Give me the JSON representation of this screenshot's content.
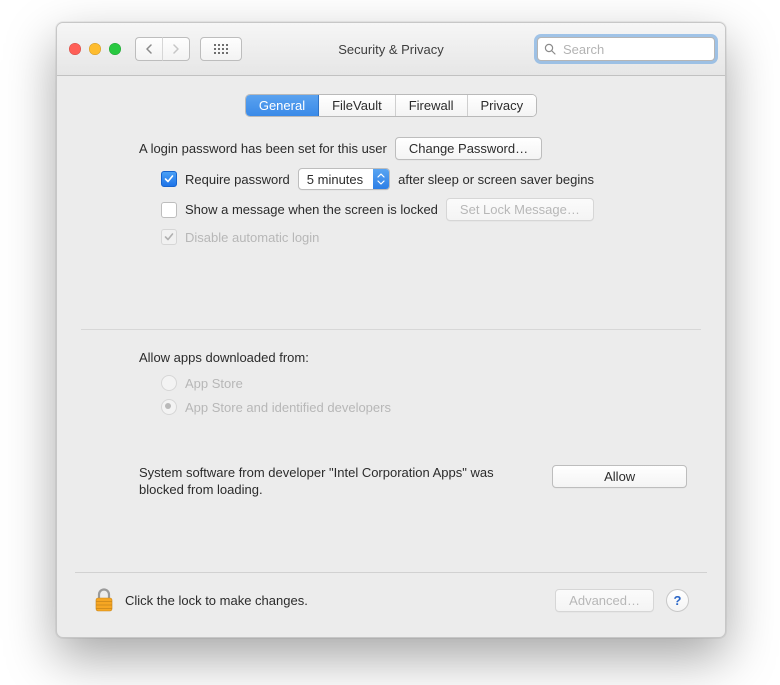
{
  "window": {
    "title": "Security & Privacy"
  },
  "toolbar": {
    "search_placeholder": "Search"
  },
  "tabs": [
    "General",
    "FileVault",
    "Firewall",
    "Privacy"
  ],
  "general": {
    "login_password_set": "A login password has been set for this user",
    "change_password_btn": "Change Password…",
    "require_password_label": "Require password",
    "require_password_delay": "5 minutes",
    "require_password_suffix": "after sleep or screen saver begins",
    "show_message_label": "Show a message when the screen is locked",
    "set_lock_message_btn": "Set Lock Message…",
    "disable_autologin_label": "Disable automatic login",
    "allow_apps_label": "Allow apps downloaded from:",
    "allow_apps_options": [
      "App Store",
      "App Store and identified developers"
    ],
    "blocked_message": "System software from developer \"Intel Corporation Apps\" was blocked from loading.",
    "allow_btn": "Allow"
  },
  "footer": {
    "lock_text": "Click the lock to make changes.",
    "advanced_btn": "Advanced…",
    "help_glyph": "?"
  }
}
